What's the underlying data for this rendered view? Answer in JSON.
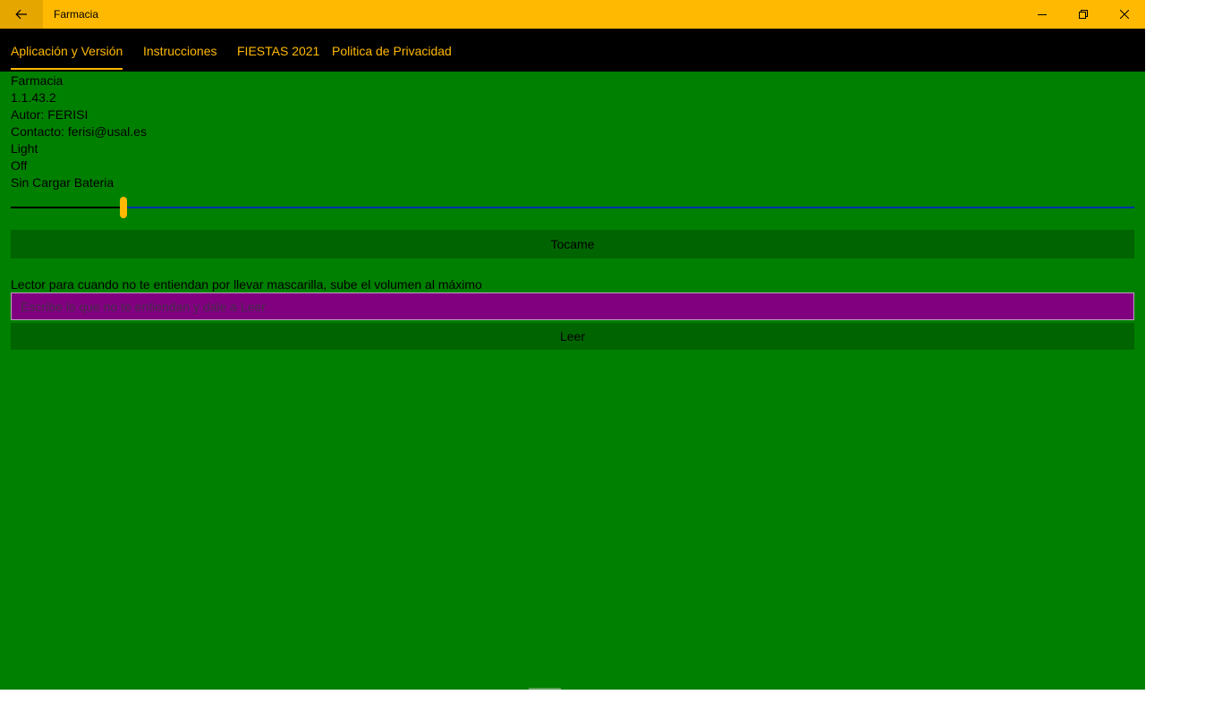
{
  "window": {
    "title": "Farmacia"
  },
  "tabs": [
    {
      "label": "Aplicación y Versión",
      "active": true
    },
    {
      "label": "Instrucciones",
      "active": false
    },
    {
      "label": "FIESTAS 2021",
      "active": false
    },
    {
      "label": "Politica de Privacidad",
      "active": false
    }
  ],
  "info": {
    "app_name": "Farmacia",
    "version": "1.1.43.2",
    "author": "Autor: FERISI",
    "contact": "Contacto: ferisi@usal.es",
    "theme": "Light",
    "state": "Off",
    "battery": "Sin Cargar Bateria"
  },
  "slider": {
    "value_percent": 10
  },
  "actions": {
    "tocame_label": "Tocame",
    "reader_description": "Lector para cuando no te entiendan por llevar mascarilla, sube el volumen al máximo",
    "reader_placeholder": "Escribe lo que no te entiendan y dale a Leer",
    "reader_value": "",
    "leer_label": "Leer"
  },
  "colors": {
    "accent": "#FFB900",
    "background": "#008000",
    "nav_background": "#000000",
    "button_background": "#006400",
    "input_background": "#800080",
    "slider_rest": "#0033AA"
  },
  "icons": {
    "back": "arrow-left-icon",
    "minimize": "minimize-icon",
    "maximize": "restore-icon",
    "close": "close-icon"
  }
}
